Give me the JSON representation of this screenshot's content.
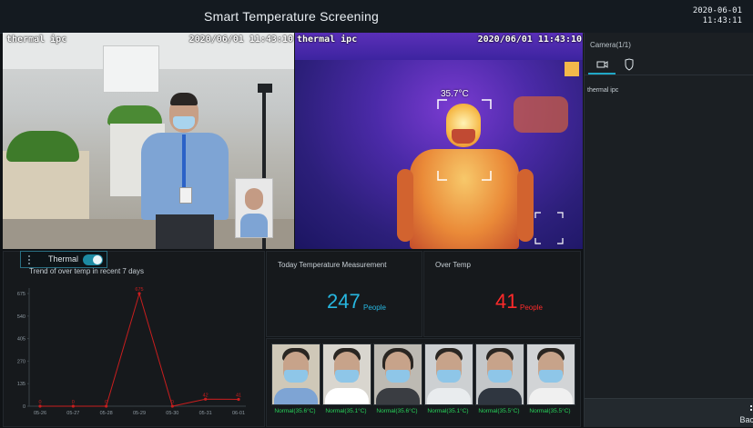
{
  "header": {
    "title": "Smart Temperature Screening",
    "date": "2020-06-01",
    "time": "11:43:11"
  },
  "video_left": {
    "osd_name": "thermal ipc",
    "osd_datetime": "2020/06/01 11:43:10"
  },
  "video_right": {
    "osd_name": "thermal ipc",
    "osd_datetime": "2020/06/01 11:43:10",
    "temperature": "35.7°C"
  },
  "thermal_toggle": {
    "label": "Thermal",
    "enabled": true
  },
  "trend": {
    "title": "Trend of over temp in recent 7 days"
  },
  "stats": {
    "today_label": "Today Temperature Measurement",
    "today_value": "247",
    "today_unit": "People",
    "over_label": "Over Temp",
    "over_value": "41",
    "over_unit": "People",
    "today_color": "#27b7e0",
    "over_color": "#ff2a2a"
  },
  "faces": [
    {
      "caption": "Normal(35.6°C)"
    },
    {
      "caption": "Normal(35.1°C)"
    },
    {
      "caption": "Normal(35.6°C)"
    },
    {
      "caption": "Normal(35.1°C)"
    },
    {
      "caption": "Normal(35.5°C)"
    },
    {
      "caption": "Normal(35.5°C)"
    }
  ],
  "sidebar": {
    "header": "Camera(1/1)",
    "tabs": [
      {
        "icon": "camera-icon",
        "active": true
      },
      {
        "icon": "shield-icon",
        "active": false
      }
    ],
    "items": [
      "thermal ipc"
    ],
    "back_label": "Bac"
  },
  "chart_data": {
    "type": "line",
    "categories": [
      "05-26",
      "05-27",
      "05-28",
      "05-29",
      "05-30",
      "05-31",
      "06-01"
    ],
    "values": [
      0,
      0,
      0,
      675,
      0,
      42,
      41
    ],
    "data_labels": [
      "0",
      "0",
      "0",
      "675",
      "0",
      "42",
      "41"
    ],
    "yticks": [
      0,
      135,
      270,
      405,
      540,
      675
    ],
    "ylim": [
      0,
      675
    ],
    "line_color": "#c81e1e",
    "title": "Trend of over temp in recent 7 days"
  }
}
